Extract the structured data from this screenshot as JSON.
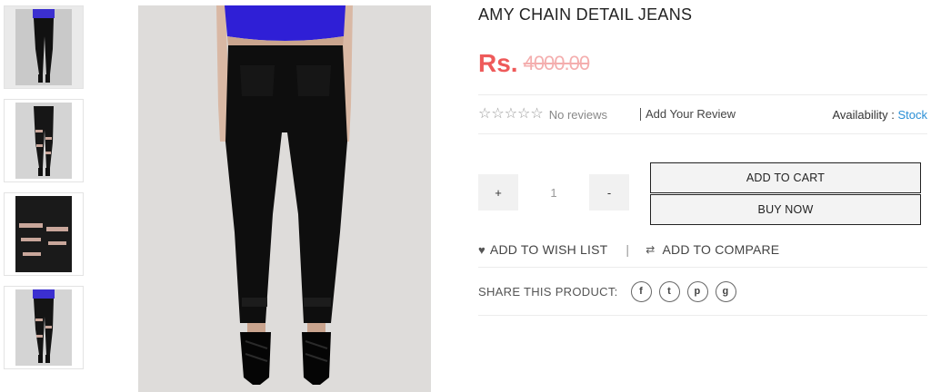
{
  "product": {
    "title": "AMY CHAIN DETAIL JEANS",
    "price_currency": "Rs.",
    "price_value": "4000.00",
    "price_color": "#ee5a5a"
  },
  "thumbnails": [
    {
      "alt": "thumbnail-1",
      "active": true
    },
    {
      "alt": "thumbnail-2",
      "active": false
    },
    {
      "alt": "thumbnail-3",
      "active": false
    },
    {
      "alt": "thumbnail-4",
      "active": false
    }
  ],
  "reviews": {
    "stars": "☆☆☆☆☆",
    "no_reviews": "No reviews",
    "add_review": "Add Your Review"
  },
  "availability": {
    "label": "Availability : ",
    "value": "Stock",
    "value_color": "#2a8fd6"
  },
  "quantity": {
    "plus": "+",
    "value": "1",
    "minus": "-"
  },
  "buttons": {
    "add_to_cart": "ADD TO CART",
    "buy_now": "BUY NOW"
  },
  "actions": {
    "wishlist": "ADD TO WISH LIST",
    "separator": "|",
    "compare": "ADD TO COMPARE"
  },
  "share": {
    "label": "SHARE THIS PRODUCT:",
    "networks": [
      "facebook-icon",
      "twitter-icon",
      "pinterest-icon",
      "google-plus-icon"
    ]
  }
}
